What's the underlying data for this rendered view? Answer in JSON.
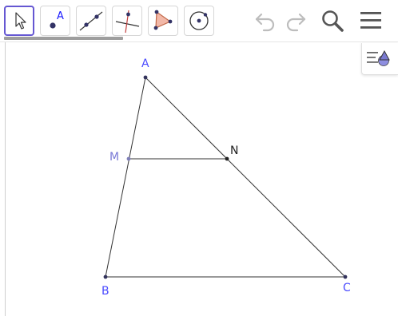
{
  "toolbar": {
    "tools": [
      {
        "name": "move-tool",
        "selected": true
      },
      {
        "name": "point-tool",
        "label": "A"
      },
      {
        "name": "line-tool"
      },
      {
        "name": "perpendicular-line-tool"
      },
      {
        "name": "polygon-tool"
      },
      {
        "name": "circle-tool"
      }
    ],
    "actions": [
      "undo",
      "redo",
      "search",
      "menu"
    ]
  },
  "construction": {
    "points": [
      {
        "name": "A",
        "color": "#4a4aff"
      },
      {
        "name": "B",
        "color": "#4a4aff"
      },
      {
        "name": "C",
        "color": "#4a4aff"
      },
      {
        "name": "M",
        "color": "#7a7ad6"
      },
      {
        "name": "N",
        "color": "#222222"
      }
    ],
    "segment_color": "#333333"
  },
  "colors": {
    "accent": "#6557d2",
    "point_label": "#4a4aff"
  }
}
